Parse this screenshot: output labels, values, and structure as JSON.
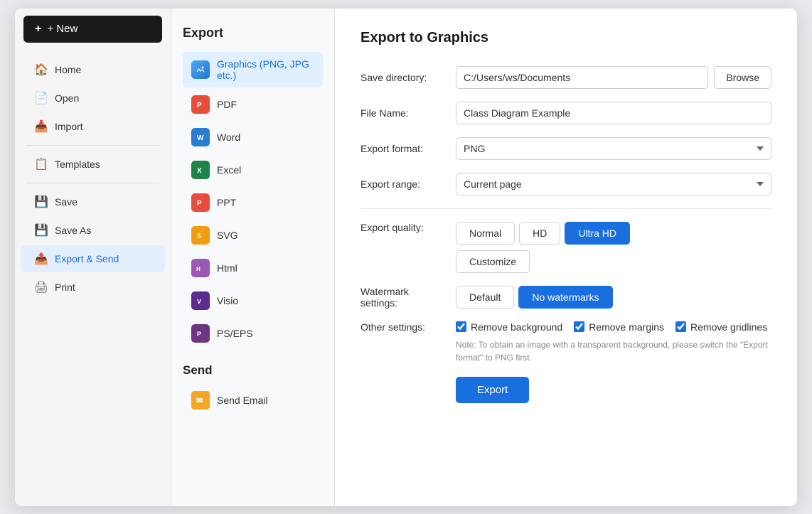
{
  "sidebar": {
    "new_button": "+ New",
    "items": [
      {
        "id": "home",
        "label": "Home",
        "icon": "🏠"
      },
      {
        "id": "open",
        "label": "Open",
        "icon": "📄"
      },
      {
        "id": "import",
        "label": "Import",
        "icon": "📥"
      },
      {
        "id": "templates",
        "label": "Templates",
        "icon": "📋"
      },
      {
        "id": "save",
        "label": "Save",
        "icon": "💾"
      },
      {
        "id": "save-as",
        "label": "Save As",
        "icon": "💾"
      },
      {
        "id": "export-send",
        "label": "Export & Send",
        "icon": "📤"
      },
      {
        "id": "print",
        "label": "Print",
        "icon": "🖨"
      }
    ]
  },
  "export_panel": {
    "title": "Export",
    "items": [
      {
        "id": "graphics",
        "label": "Graphics (PNG, JPG etc.)",
        "iconClass": "icon-graphics",
        "iconText": "🖼"
      },
      {
        "id": "pdf",
        "label": "PDF",
        "iconClass": "icon-pdf",
        "iconText": "P"
      },
      {
        "id": "word",
        "label": "Word",
        "iconClass": "icon-word",
        "iconText": "W"
      },
      {
        "id": "excel",
        "label": "Excel",
        "iconClass": "icon-excel",
        "iconText": "X"
      },
      {
        "id": "ppt",
        "label": "PPT",
        "iconClass": "icon-ppt",
        "iconText": "P"
      },
      {
        "id": "svg",
        "label": "SVG",
        "iconClass": "icon-svg",
        "iconText": "S"
      },
      {
        "id": "html",
        "label": "Html",
        "iconClass": "icon-html",
        "iconText": "H"
      },
      {
        "id": "visio",
        "label": "Visio",
        "iconClass": "icon-visio",
        "iconText": "V"
      },
      {
        "id": "pseps",
        "label": "PS/EPS",
        "iconClass": "icon-pseps",
        "iconText": "P"
      }
    ],
    "send_title": "Send",
    "send_items": [
      {
        "id": "email",
        "label": "Send Email",
        "iconClass": "icon-email",
        "iconText": "✉"
      }
    ]
  },
  "right_panel": {
    "title": "Export to Graphics",
    "save_directory_label": "Save directory:",
    "save_directory_value": "C:/Users/ws/Documents",
    "browse_label": "Browse",
    "file_name_label": "File Name:",
    "file_name_value": "Class Diagram Example",
    "export_format_label": "Export format:",
    "export_format_value": "PNG",
    "export_range_label": "Export range:",
    "export_range_value": "Current page",
    "export_quality_label": "Export quality:",
    "quality_options": [
      {
        "id": "normal",
        "label": "Normal",
        "selected": false
      },
      {
        "id": "hd",
        "label": "HD",
        "selected": false
      },
      {
        "id": "ultrahd",
        "label": "Ultra HD",
        "selected": true
      }
    ],
    "customize_label": "Customize",
    "watermark_label": "Watermark settings:",
    "watermark_options": [
      {
        "id": "default",
        "label": "Default",
        "selected": false
      },
      {
        "id": "no-watermarks",
        "label": "No watermarks",
        "selected": true
      }
    ],
    "other_settings_label": "Other settings:",
    "checkboxes": [
      {
        "id": "remove-bg",
        "label": "Remove background",
        "checked": true
      },
      {
        "id": "remove-margins",
        "label": "Remove margins",
        "checked": true
      },
      {
        "id": "remove-gridlines",
        "label": "Remove gridlines",
        "checked": true
      }
    ],
    "note": "Note: To obtain an image with a transparent background, please switch the \"Export format\" to PNG first.",
    "export_button": "Export"
  }
}
